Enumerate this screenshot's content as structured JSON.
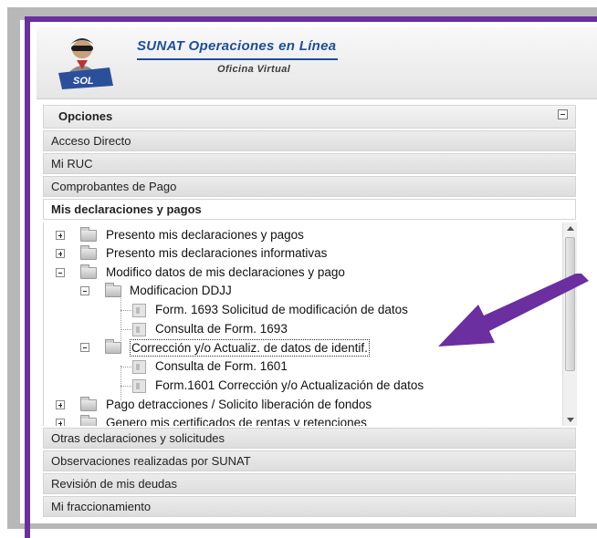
{
  "header": {
    "title": "SUNAT Operaciones en Línea",
    "subtitle": "Oficina Virtual",
    "logo_badge": "SOL"
  },
  "menu": {
    "opciones_label": "Opciones",
    "sections": [
      {
        "label": "Acceso Directo"
      },
      {
        "label": "Mi RUC"
      },
      {
        "label": "Comprobantes de Pago"
      },
      {
        "label": "Mis declaraciones y pagos"
      }
    ],
    "tree": [
      {
        "label": "Presento mis declaraciones y pagos",
        "type": "folder",
        "expanded": false
      },
      {
        "label": "Presento mis declaraciones informativas",
        "type": "folder",
        "expanded": false
      },
      {
        "label": "Modifico datos de mis declaraciones y pago",
        "type": "folder",
        "expanded": true
      },
      {
        "label": "Modificacion DDJJ",
        "type": "folder",
        "expanded": true
      },
      {
        "label": "Form. 1693 Solicitud de modificación de datos",
        "type": "doc"
      },
      {
        "label": "Consulta de Form. 1693",
        "type": "doc"
      },
      {
        "label": "Corrección y/o Actualiz. de datos de identif.",
        "type": "folder",
        "expanded": true,
        "selected": true
      },
      {
        "label": "Consulta de Form. 1601",
        "type": "doc"
      },
      {
        "label": "Form.1601 Corrección y/o Actualización de datos",
        "type": "doc"
      },
      {
        "label": "Pago detracciones / Solicito liberación de fondos",
        "type": "folder",
        "expanded": false
      },
      {
        "label": "Genero mis certificados de rentas y retenciones",
        "type": "folder",
        "expanded": false
      }
    ],
    "bottom_sections": [
      {
        "label": "Otras declaraciones y solicitudes"
      },
      {
        "label": "Observaciones realizadas por SUNAT"
      },
      {
        "label": "Revisión de mis deudas"
      },
      {
        "label": "Mi fraccionamiento"
      }
    ]
  },
  "colors": {
    "annotation_purple": "#6b2fa0",
    "brand_blue": "#1d4f9a"
  }
}
